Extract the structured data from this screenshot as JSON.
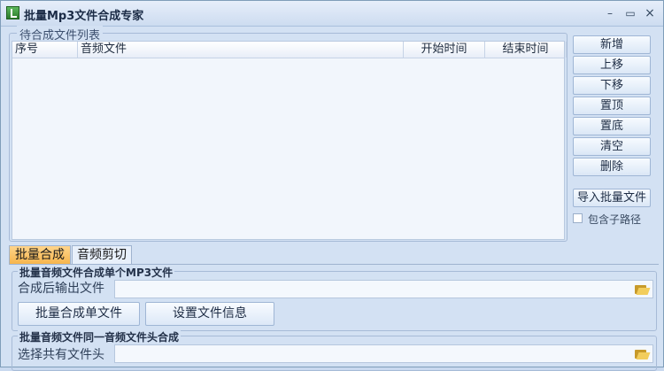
{
  "window": {
    "title": "批量Mp3文件合成专家",
    "controls": {
      "minimize": "–",
      "maximize": "▭",
      "close": "×"
    }
  },
  "list_group": {
    "label": "待合成文件列表",
    "columns": [
      "序号",
      "音频文件",
      "开始时间",
      "结束时间"
    ],
    "rows": []
  },
  "side_buttons": {
    "add": "新增",
    "move_up": "上移",
    "move_down": "下移",
    "top": "置顶",
    "bottom": "置底",
    "clear": "清空",
    "delete": "删除",
    "import_batch": "导入批量文件"
  },
  "include_subpath": {
    "label": "包含子路径",
    "checked": false
  },
  "tabs": [
    {
      "label": "批量合成",
      "active": true
    },
    {
      "label": "音频剪切",
      "active": false
    }
  ],
  "merge_single": {
    "group_label": "批量音频文件合成单个MP3文件",
    "output_label": "合成后输出文件",
    "output_value": "",
    "btn_merge": "批量合成单文件",
    "btn_set_info": "设置文件信息"
  },
  "merge_header": {
    "group_label": "批量音频文件同一音频文件头合成",
    "header_label": "选择共有文件头",
    "header_value": ""
  },
  "colors": {
    "window_bg": "#d3e1f3",
    "active_tab": "#f6b44a",
    "list_bg": "#f2f6fc"
  }
}
